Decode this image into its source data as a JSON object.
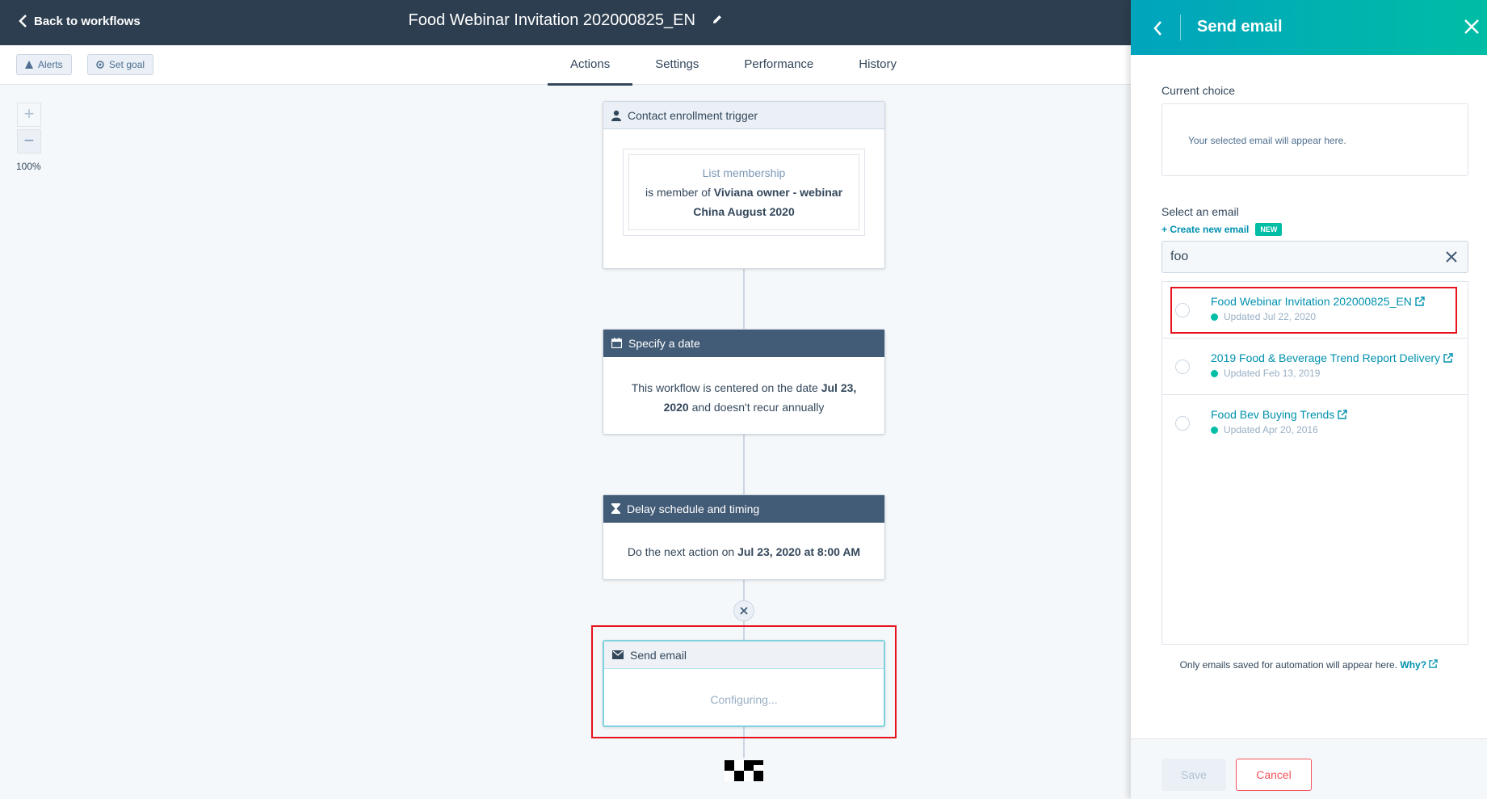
{
  "header": {
    "back_label": "Back to workflows",
    "workflow_title": "Food Webinar Invitation 202000825_EN"
  },
  "toolbar": {
    "alerts_label": "Alerts",
    "set_goal_label": "Set goal",
    "tabs": [
      {
        "label": "Actions",
        "active": true
      },
      {
        "label": "Settings",
        "active": false
      },
      {
        "label": "Performance",
        "active": false
      },
      {
        "label": "History",
        "active": false
      }
    ]
  },
  "zoom": {
    "plus": "+",
    "minus": "−",
    "level": "100%"
  },
  "workflow": {
    "trigger": {
      "title": "Contact enrollment trigger",
      "filter_type": "List membership",
      "filter_prefix": "is member of",
      "filter_value": "Viviana owner - webinar China August 2020"
    },
    "date": {
      "title": "Specify a date",
      "text_prefix": "This workflow is centered on the date",
      "date_value": "Jul 23, 2020",
      "text_suffix": "and doesn't recur annually"
    },
    "delay": {
      "title": "Delay schedule and timing",
      "text_prefix": "Do the next action on",
      "datetime_value": "Jul 23, 2020 at 8:00 AM"
    },
    "send_email": {
      "title": "Send email",
      "status": "Configuring..."
    }
  },
  "panel": {
    "title": "Send email",
    "current_choice_label": "Current choice",
    "current_choice_placeholder": "Your selected email will appear here.",
    "select_label": "Select an email",
    "create_link": "+ Create new email",
    "new_badge": "NEW",
    "search_value": "foo",
    "results": [
      {
        "name": "Food Webinar Invitation 202000825_EN",
        "updated": "Updated Jul 22, 2020"
      },
      {
        "name": "2019 Food & Beverage Trend Report Delivery",
        "updated": "Updated Feb 13, 2019"
      },
      {
        "name": "Food Bev Buying Trends",
        "updated": "Updated Apr 20, 2016"
      }
    ],
    "footnote_text": "Only emails saved for automation will appear here.",
    "footnote_link": "Why?",
    "save_label": "Save",
    "cancel_label": "Cancel"
  },
  "colors": {
    "header_bg": "#2d3e50",
    "panel_gradient_start": "#00a4bd",
    "panel_gradient_end": "#00bda5",
    "link": "#0091ae",
    "highlight_red": "#e6131d",
    "cancel": "#f2545b"
  }
}
